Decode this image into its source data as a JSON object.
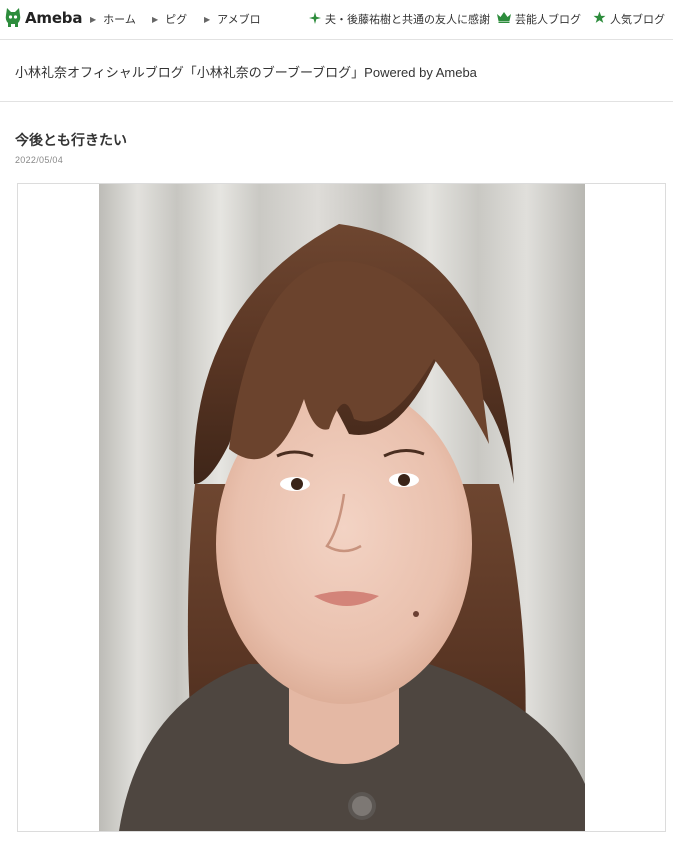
{
  "header": {
    "logo": {
      "text": "Ameba",
      "icon": "ameba-logo-icon"
    },
    "nav": [
      {
        "label": "ホーム"
      },
      {
        "label": "ピグ"
      },
      {
        "label": "アメブロ"
      }
    ],
    "links": [
      {
        "label": "夫・後藤祐樹と共通の友人に感謝",
        "icon": "sparkle-icon"
      },
      {
        "label": "芸能人ブログ",
        "icon": "crown-icon"
      },
      {
        "label": "人気ブログ",
        "icon": "star-icon"
      }
    ]
  },
  "blog": {
    "title": "小林礼奈オフィシャルブログ「小林礼奈のブーブーブログ」Powered by Ameba"
  },
  "entry": {
    "title": "今後とも行きたい",
    "date": "2022/05/04",
    "photo": {
      "subject": "selfie-photo"
    }
  },
  "colors": {
    "brand_green": "#2d8c3c",
    "text": "#333333",
    "rule": "#e2e2e2"
  }
}
